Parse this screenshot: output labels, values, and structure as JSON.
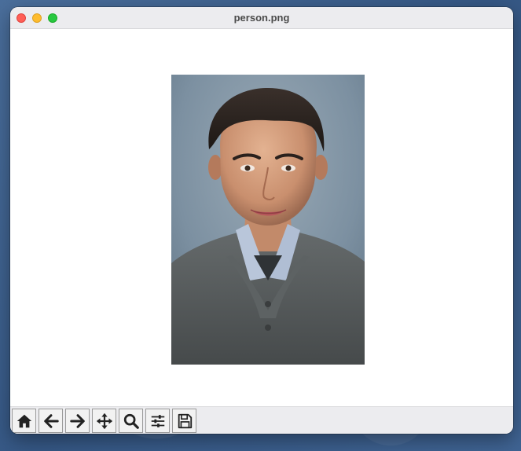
{
  "window": {
    "title": "person.png"
  },
  "titlebar": {
    "buttons": [
      {
        "name": "close",
        "color": "#ff5f57"
      },
      {
        "name": "minimize",
        "color": "#febc2e"
      },
      {
        "name": "zoom",
        "color": "#28c840"
      }
    ]
  },
  "figure": {
    "description_icon": "portrait-photo"
  },
  "toolbar": {
    "items": [
      {
        "icon": "home-icon"
      },
      {
        "icon": "back-arrow-icon"
      },
      {
        "icon": "forward-arrow-icon"
      },
      {
        "icon": "pan-move-icon"
      },
      {
        "icon": "zoom-magnifier-icon"
      },
      {
        "icon": "configure-subplots-icon"
      },
      {
        "icon": "save-floppy-icon"
      }
    ]
  },
  "colors": {
    "titlebar_bg": "#ececef",
    "toolbar_bg": "#ececef",
    "canvas_bg": "#ffffff",
    "photo_background": "#7b8fa0",
    "sweater": "#55595a"
  }
}
